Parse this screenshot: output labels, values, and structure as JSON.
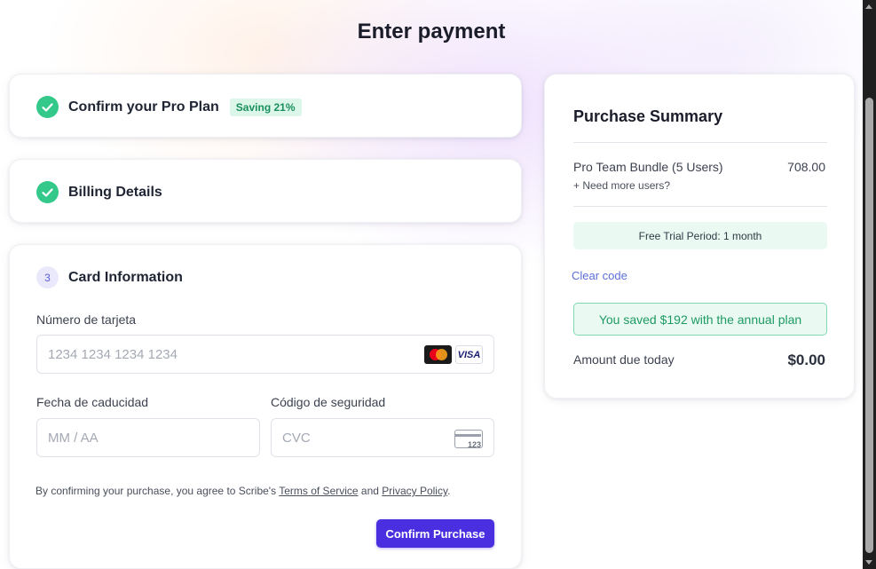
{
  "page": {
    "title": "Enter payment"
  },
  "steps": {
    "plan": {
      "title": "Confirm your Pro Plan",
      "badge": "Saving 21%"
    },
    "billing": {
      "title": "Billing Details"
    },
    "card": {
      "number": "3",
      "title": "Card Information"
    }
  },
  "card_form": {
    "number_label": "Número de tarjeta",
    "number_placeholder": "1234 1234 1234 1234",
    "expiry_label": "Fecha de caducidad",
    "expiry_placeholder": "MM / AA",
    "cvc_label": "Código de seguridad",
    "cvc_placeholder": "CVC",
    "card_brands": [
      "mastercard-icon",
      "visa-icon"
    ],
    "visa_text": "VISA",
    "cvc_icon_text": "123"
  },
  "terms": {
    "prefix": "By confirming your purchase, you agree to Scribe's ",
    "tos": "Terms of Service",
    "and": " and ",
    "privacy": "Privacy Policy",
    "suffix": "."
  },
  "confirm_button": "Confirm Purchase",
  "summary": {
    "title": "Purchase Summary",
    "item_name": "Pro Team Bundle (5 Users)",
    "item_price": "708.00",
    "more_users": "+ Need more users?",
    "trial": "Free Trial Period: 1 month",
    "clear_code": "Clear code",
    "saved": "You saved $192 with the annual plan",
    "due_label": "Amount due today",
    "due_value": "$0.00"
  },
  "colors": {
    "accent": "#4a2fe0",
    "success": "#34c98b",
    "saved_text": "#1e9a63",
    "link": "#5c6fd6"
  }
}
